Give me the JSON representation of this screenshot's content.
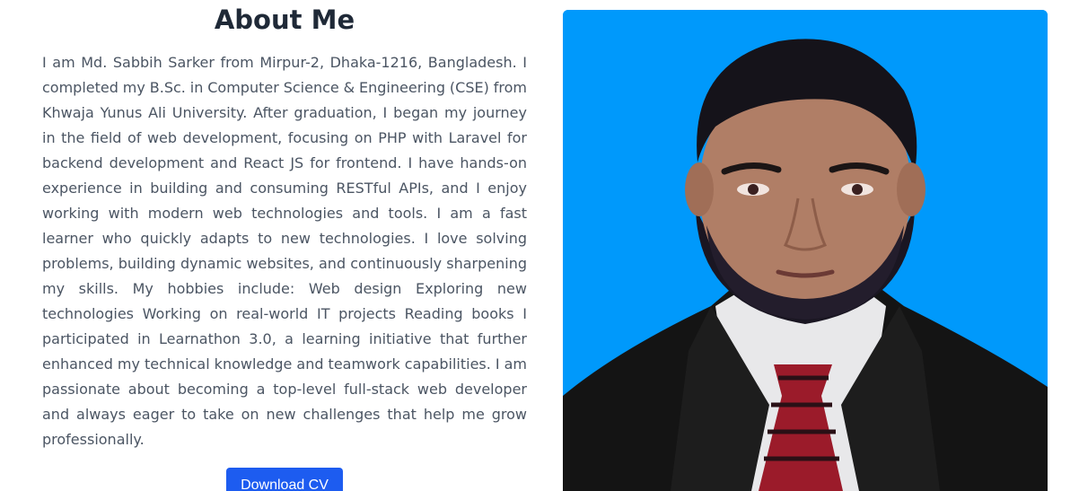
{
  "about": {
    "title": "About Me",
    "bio": "I am Md. Sabbih Sarker from Mirpur-2, Dhaka-1216, Bangladesh. I completed my B.Sc. in Computer Science & Engineering (CSE) from Khwaja Yunus Ali University. After graduation, I began my journey in the field of web development, focusing on PHP with Laravel for backend development and React JS for frontend. I have hands-on experience in building and consuming RESTful APIs, and I enjoy working with modern web technologies and tools. I am a fast learner who quickly adapts to new technologies. I love solving problems, building dynamic websites, and continuously sharpening my skills. My hobbies include: Web design Exploring new technologies Working on real-world IT projects Reading books I participated in Learnathon 3.0, a learning initiative that further enhanced my technical knowledge and teamwork capabilities. I am passionate about becoming a top-level full-stack web developer and always eager to take on new challenges that help me grow professionally.",
    "download_label": "Download CV"
  },
  "photo": {
    "background_color": "#0099fb"
  },
  "colors": {
    "accent": "#1d5cf0",
    "heading": "#1f2937",
    "body_text": "#4b5563"
  }
}
